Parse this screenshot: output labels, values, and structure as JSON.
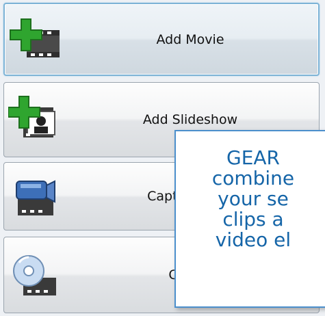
{
  "buttons": [
    {
      "label": "Add Movie",
      "icon": "film-add-icon",
      "focused": true
    },
    {
      "label": "Add Slideshow",
      "icon": "slideshow-add-icon"
    },
    {
      "label": "Capture from",
      "icon": "camcorder-film-icon"
    },
    {
      "label": "Create",
      "icon": "disc-film-icon"
    }
  ],
  "tooltip": {
    "text": "GEAR\ncombine\nyour se\nclips a\nvideo el"
  },
  "colors": {
    "tooltip_border": "#4b8fcc",
    "tooltip_text": "#1565a8",
    "plus_green": "#2fa52f"
  }
}
